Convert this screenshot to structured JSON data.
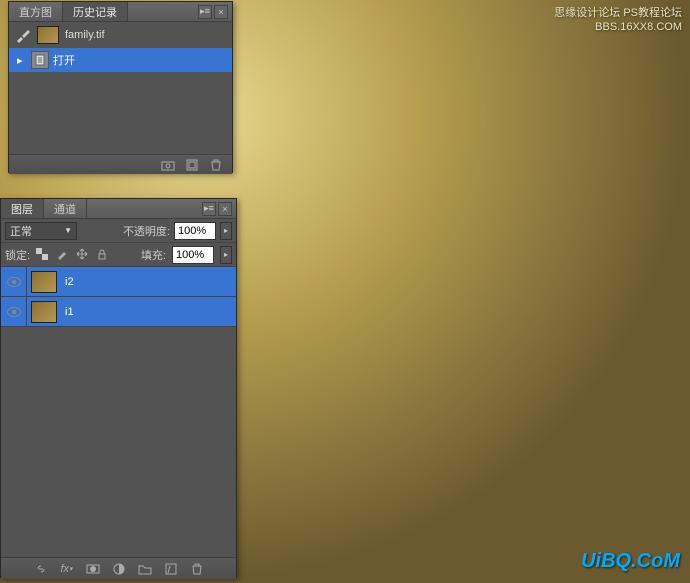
{
  "watermarks": {
    "top_right_line1": "思缘设计论坛  PS教程论坛",
    "top_right_line2": "BBS.16XX8.COM",
    "bottom_right": "UiBQ.CoM"
  },
  "history_panel": {
    "tabs": [
      "直方图",
      "历史记录"
    ],
    "active_tab": 1,
    "document": "family.tif",
    "items": [
      {
        "icon": "doc",
        "label": "打开",
        "selected": true
      }
    ]
  },
  "layers_panel": {
    "tabs": [
      "图层",
      "通道"
    ],
    "active_tab": 0,
    "blend_mode": "正常",
    "opacity_label": "不透明度:",
    "opacity_value": "100%",
    "lock_label": "锁定:",
    "fill_label": "填充:",
    "fill_value": "100%",
    "layers": [
      {
        "name": "i2",
        "visible": true,
        "selected": true
      },
      {
        "name": "i1",
        "visible": true,
        "selected": true
      }
    ]
  }
}
